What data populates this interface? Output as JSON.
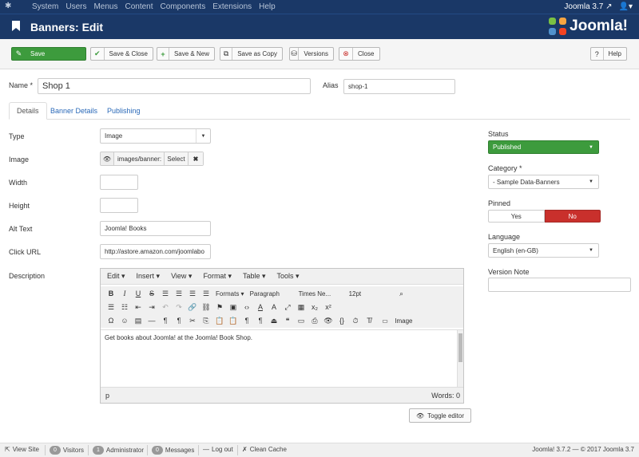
{
  "topnav": {
    "menu": [
      "System",
      "Users",
      "Menus",
      "Content",
      "Components",
      "Extensions",
      "Help"
    ],
    "site": "Joomla 3.7",
    "user_icon": "user-icon"
  },
  "header": {
    "title": "Banners: Edit",
    "logo_text": "Joomla!"
  },
  "toolbar": {
    "save": "Save",
    "save_close": "Save & Close",
    "save_new": "Save & New",
    "save_copy": "Save as Copy",
    "versions": "Versions",
    "close": "Close",
    "help": "Help"
  },
  "form": {
    "name_label": "Name *",
    "name_value": "Shop 1",
    "alias_label": "Alias",
    "alias_value": "shop-1"
  },
  "tabs": [
    "Details",
    "Banner Details",
    "Publishing"
  ],
  "details": {
    "type_label": "Type",
    "type_value": "Image",
    "image_label": "Image",
    "image_value": "images/banner:",
    "image_select": "Select",
    "width_label": "Width",
    "height_label": "Height",
    "alt_label": "Alt Text",
    "alt_value": "Joomla! Books",
    "url_label": "Click URL",
    "url_value": "http://astore.amazon.com/joomlabo",
    "desc_label": "Description"
  },
  "editor": {
    "menus": [
      "Edit ▾",
      "Insert ▾",
      "View ▾",
      "Format ▾",
      "Table ▾",
      "Tools ▾"
    ],
    "formats": "Formats ▾",
    "paragraph": "Paragraph",
    "font": "Times Ne...",
    "size": "12pt",
    "image_btn": "Image",
    "content": "Get books about Joomla! at the Joomla! Book Shop.",
    "path": "p",
    "words": "Words: 0",
    "toggle": "Toggle editor"
  },
  "sidebar": {
    "status_label": "Status",
    "status_value": "Published",
    "category_label": "Category *",
    "category_value": "- Sample Data-Banners",
    "pinned_label": "Pinned",
    "pinned_yes": "Yes",
    "pinned_no": "No",
    "language_label": "Language",
    "language_value": "English (en-GB)",
    "version_label": "Version Note"
  },
  "footer": {
    "view_site": "View Site",
    "visitors_count": "0",
    "visitors": "Visitors",
    "admin_count": "1",
    "admin": "Administrator",
    "messages_count": "0",
    "messages": "Messages",
    "logout": "Log out",
    "clean_cache": "Clean Cache",
    "version": "Joomla! 3.7.2 — © 2017 Joomla 3.7"
  },
  "colors": {
    "nav": "#1a3867",
    "green": "#3d9b3d",
    "red": "#c9302c"
  }
}
